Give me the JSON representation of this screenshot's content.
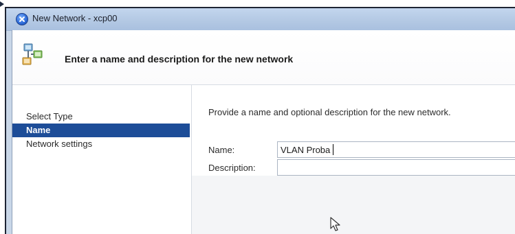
{
  "window": {
    "title": "New Network - xcp00"
  },
  "header": {
    "heading": "Enter a name and description for the new network"
  },
  "sidebar": {
    "items": [
      {
        "label": "Select Type",
        "selected": false
      },
      {
        "label": "Name",
        "selected": true
      },
      {
        "label": "Network settings",
        "selected": false
      }
    ]
  },
  "main": {
    "instruction": "Provide a name and optional description for the new network.",
    "name_field": {
      "label": "Name:",
      "value": "VLAN Proba"
    },
    "description_field": {
      "label": "Description:",
      "value": ""
    }
  },
  "colors": {
    "selection": "#1d4d98",
    "titlebar": "#b4c9e4"
  },
  "icons": {
    "app": "xcp-app-icon",
    "header": "network-icon",
    "pointer": "mouse-cursor-icon"
  }
}
